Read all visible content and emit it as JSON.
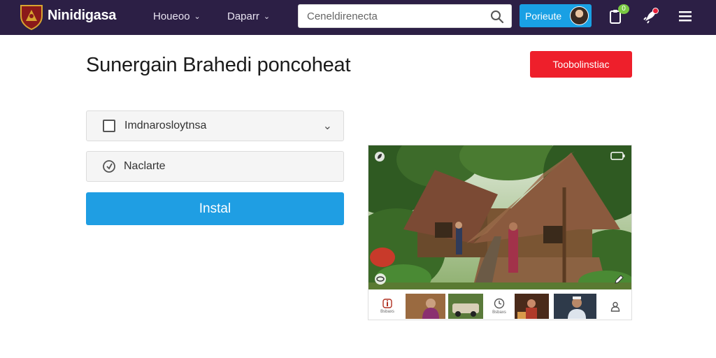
{
  "header": {
    "brand": "Ninidigasa",
    "nav": [
      {
        "label": "Houeoo"
      },
      {
        "label": "Daparr"
      }
    ],
    "search": {
      "placeholder": "Ceneldirenecta"
    },
    "profile_label": "Porieute",
    "notification_count": "0"
  },
  "main": {
    "title": "Sunergain Brahedi poncoheat",
    "cta_label": "Toobolinstiac",
    "select_field": {
      "label": "Imdnarosloytnsa"
    },
    "second_field": {
      "label": "Naclarte"
    },
    "install_label": "Instal"
  },
  "media": {
    "thumbnails": [
      {
        "kind": "icon",
        "icon": "info-icon",
        "caption": "Bsbaxs"
      },
      {
        "kind": "photo",
        "subject": "woman"
      },
      {
        "kind": "photo",
        "subject": "car"
      },
      {
        "kind": "icon",
        "icon": "clock-icon",
        "caption": "Bsbaxs"
      },
      {
        "kind": "photo",
        "subject": "cooking"
      },
      {
        "kind": "photo",
        "subject": "man"
      },
      {
        "kind": "icon",
        "icon": "user-icon",
        "caption": ""
      }
    ]
  },
  "colors": {
    "topbar": "#2c1f45",
    "primary_blue": "#1f9ee3",
    "cta_red": "#ee1f2b"
  }
}
